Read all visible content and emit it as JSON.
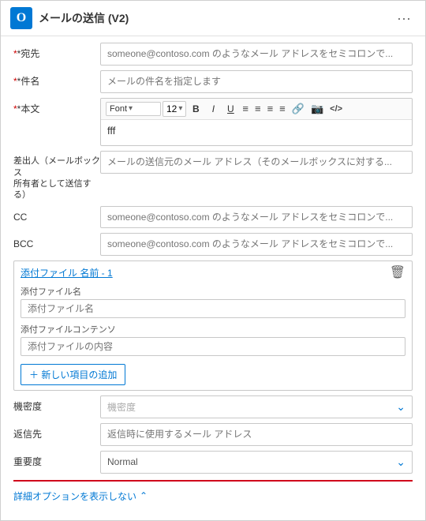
{
  "header": {
    "title": "メールの送信 (V2)",
    "more_label": "···",
    "icon_label": "O"
  },
  "form": {
    "to_label": "*宛先",
    "to_placeholder": "someone@contoso.com のようなメール アドレスをセミコロンで...",
    "subject_label": "*件名",
    "subject_placeholder": "メールの件名を指定します",
    "body_label": "*本文",
    "font_label": "Font",
    "font_dropdown_arrow": "▾",
    "font_size_label": "12",
    "font_size_arrow": "▾",
    "bold_label": "B",
    "italic_label": "I",
    "underline_label": "U",
    "body_content": "fff",
    "toolbar_icons": [
      "≡",
      "≡",
      "≡",
      "≡",
      "≡",
      "🔗",
      "🔗",
      "</>"
    ],
    "from_label": "差出人（メールボックス\n所有者として送信する）",
    "from_placeholder": "メールの送信元のメール アドレス（そのメールボックスに対する...",
    "cc_label": "CC",
    "cc_placeholder": "someone@contoso.com のようなメール アドレスをセミコロンで...",
    "bcc_label": "BCC",
    "bcc_placeholder": "someone@contoso.com のようなメール アドレスをセミコロンで...",
    "attachments_header": "添付ファイル 名前 - 1",
    "attachment_name_label": "添付ファイル名",
    "attachment_name_placeholder": "添付ファイル名",
    "attachment_content_label": "添付ファイルコンテンソ",
    "attachment_content_placeholder": "添付ファイルの内容",
    "add_item_label": "＋  新しい項目の追加",
    "sensitivity_label": "機密度",
    "sensitivity_placeholder": "機密度",
    "reply_to_label": "返信先",
    "reply_to_placeholder": "返信時に使用するメール アドレス",
    "importance_label": "重要度",
    "importance_value": "Normal",
    "bottom_link_label": "詳細オプションを表示しない",
    "bottom_link_arrow": "へ"
  }
}
